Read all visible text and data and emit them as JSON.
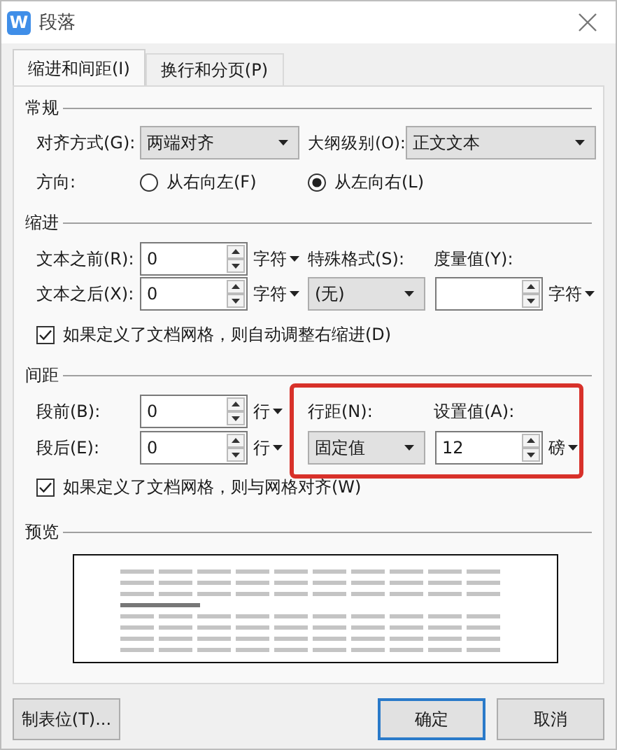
{
  "window": {
    "title": "段落",
    "icon_letter": "W"
  },
  "tabs": [
    {
      "label": "缩进和间距(I)",
      "selected": true
    },
    {
      "label": "换行和分页(P)",
      "selected": false
    }
  ],
  "general": {
    "heading": "常规",
    "alignment": {
      "label": "对齐方式(G):",
      "value": "两端对齐"
    },
    "outline_level": {
      "label": "大纲级别(O):",
      "value": "正文文本"
    },
    "direction": {
      "label": "方向:",
      "options": [
        {
          "label": "从右向左(F)",
          "selected": false
        },
        {
          "label": "从左向右(L)",
          "selected": true
        }
      ]
    }
  },
  "indent": {
    "heading": "缩进",
    "before": {
      "label": "文本之前(R):",
      "value": "0",
      "unit": "字符"
    },
    "after": {
      "label": "文本之后(X):",
      "value": "0",
      "unit": "字符"
    },
    "special": {
      "label": "特殊格式(S):",
      "value": "(无)"
    },
    "measure": {
      "label": "度量值(Y):",
      "unit": "字符"
    },
    "checkbox": {
      "label": "如果定义了文档网格，则自动调整右缩进(D)",
      "checked": true
    }
  },
  "spacing": {
    "heading": "间距",
    "before": {
      "label": "段前(B):",
      "value": "0",
      "unit": "行"
    },
    "after": {
      "label": "段后(E):",
      "value": "0",
      "unit": "行"
    },
    "line_spacing": {
      "label": "行距(N):",
      "value": "固定值"
    },
    "setting": {
      "label": "设置值(A):",
      "value": "12",
      "unit": "磅"
    },
    "checkbox": {
      "label": "如果定义了文档网格，则与网格对齐(W)",
      "checked": true
    }
  },
  "preview": {
    "heading": "预览"
  },
  "buttons": [
    {
      "label": "制表位(T)...",
      "default": false
    },
    {
      "label": "确定",
      "default": true
    },
    {
      "label": "取消",
      "default": false
    }
  ]
}
